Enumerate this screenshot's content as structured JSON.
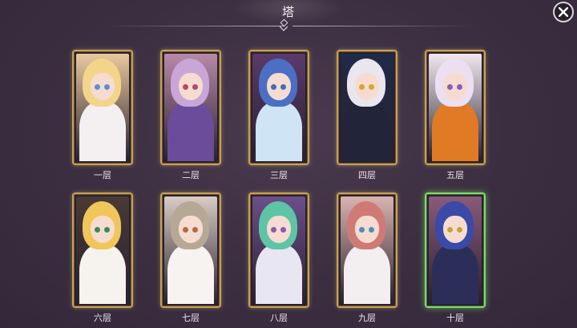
{
  "header": {
    "title": "塔"
  },
  "close_button": {
    "icon": "close-icon"
  },
  "floors": [
    {
      "label": "一层",
      "hair": "#f2d58a",
      "eye": "#5c8fd6",
      "body": "#f4f0f2",
      "bg": "#e8c89e",
      "active": false
    },
    {
      "label": "二层",
      "hair": "#c9a6d8",
      "eye": "#b04a66",
      "body": "#6a4c9a",
      "bg": "#b88aa8",
      "active": false
    },
    {
      "label": "三层",
      "hair": "#4a6fc4",
      "eye": "#3f6fb8",
      "body": "#cfe4f4",
      "bg": "#5a3a6a",
      "active": false
    },
    {
      "label": "四层",
      "hair": "#e9e6ee",
      "eye": "#d9a23a",
      "body": "#22253a",
      "bg": "#1f2a48",
      "active": false
    },
    {
      "label": "五层",
      "hair": "#eddff2",
      "eye": "#8a5bc4",
      "body": "#e07a24",
      "bg": "#f1e8ee",
      "active": false
    },
    {
      "label": "六层",
      "hair": "#f0c65a",
      "eye": "#3c8a5c",
      "body": "#f6f2ee",
      "bg": "#4a3a36",
      "active": false
    },
    {
      "label": "七层",
      "hair": "#b7a896",
      "eye": "#b06a4a",
      "body": "#f6f3f0",
      "bg": "#d8ccc4",
      "active": false
    },
    {
      "label": "八层",
      "hair": "#5ec4a6",
      "eye": "#8a5ab4",
      "body": "#e8e6f2",
      "bg": "#6b4f8a",
      "active": false
    },
    {
      "label": "九层",
      "hair": "#d07a76",
      "eye": "#4f8fb8",
      "body": "#f3eef0",
      "bg": "#d8b4b0",
      "active": false
    },
    {
      "label": "十层",
      "hair": "#3a4aa8",
      "eye": "#c4a43a",
      "body": "#2c2e5a",
      "bg": "#8a5a7a",
      "active": true
    }
  ],
  "colors": {
    "card_border": "#c8a14e",
    "card_border_active": "#7fd86a",
    "background": "#3d2f41"
  }
}
